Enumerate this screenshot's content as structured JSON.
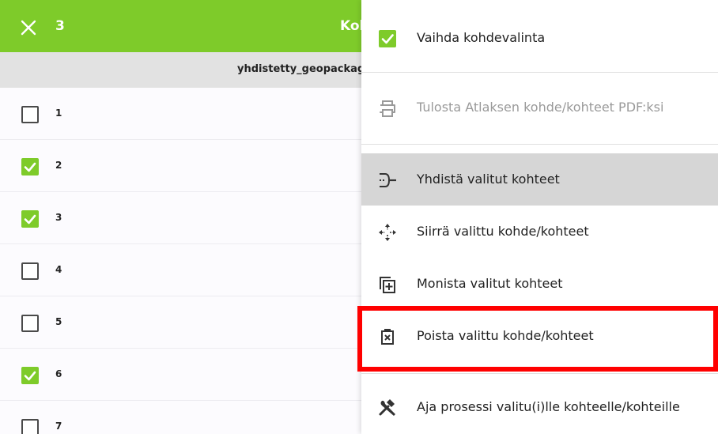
{
  "topbar": {
    "count": "3",
    "title": "Kohteet"
  },
  "column": {
    "header": "yhdistetty_geopackage"
  },
  "rows": [
    {
      "label": "1",
      "checked": false
    },
    {
      "label": "2",
      "checked": true
    },
    {
      "label": "3",
      "checked": true
    },
    {
      "label": "4",
      "checked": false
    },
    {
      "label": "5",
      "checked": false
    },
    {
      "label": "6",
      "checked": true
    },
    {
      "label": "7",
      "checked": false
    }
  ],
  "menu": {
    "toggle_selection": "Vaihda kohdevalinta",
    "print_atlas": "Tulosta Atlaksen kohde/kohteet PDF:ksi",
    "merge": "Yhdistä valitut kohteet",
    "move": "Siirrä valittu kohde/kohteet",
    "duplicate": "Monista valitut kohteet",
    "delete": "Poista valittu kohde/kohteet",
    "run_process": "Aja prosessi valitu(i)lle kohteelle/kohteille"
  },
  "icons": {
    "close": "close-icon",
    "checkbox": "checkbox-icon",
    "print": "printer-icon",
    "merge": "merge-icon",
    "move": "move-icon",
    "duplicate": "duplicate-icon",
    "delete": "delete-icon",
    "process": "tools-icon"
  },
  "colors": {
    "accent": "#7ecb2a",
    "highlight": "#ff0000",
    "active_item": "#d6d6d6"
  }
}
